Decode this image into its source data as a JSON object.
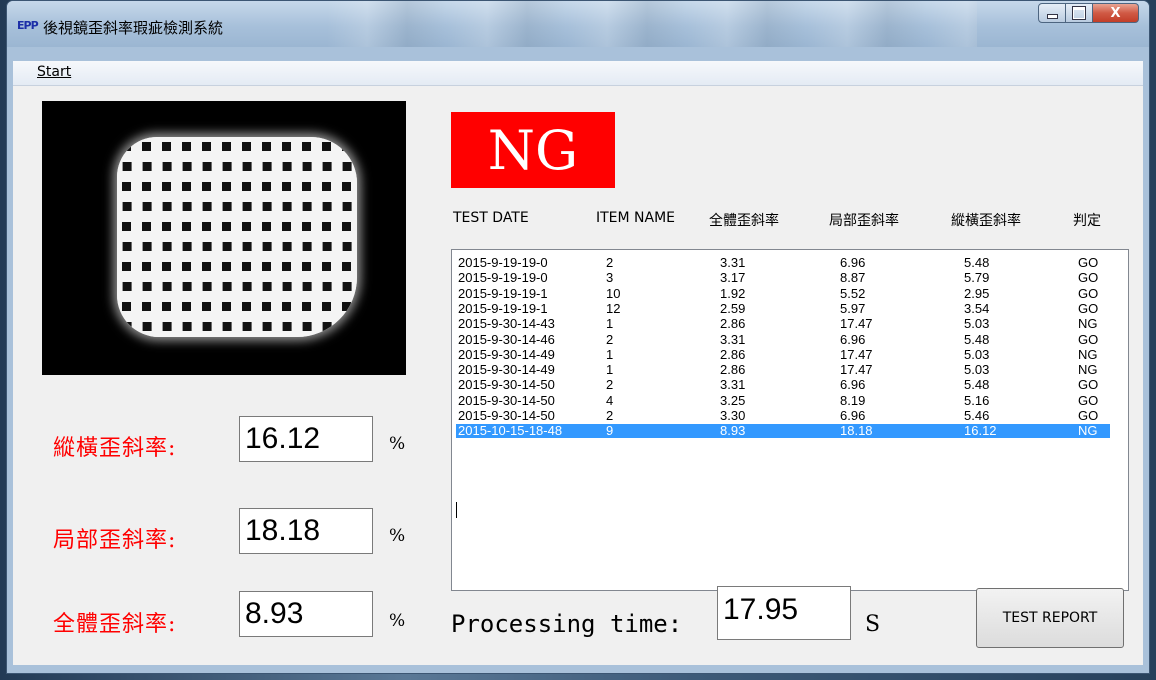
{
  "window": {
    "title": "後視鏡歪斜率瑕疵檢測系統",
    "icon_text": "EPP",
    "minimize_symbol": "",
    "maximize_symbol": "",
    "close_symbol": "X"
  },
  "menu": {
    "start_label": "Start"
  },
  "result": {
    "status": "NG",
    "status_color": "#ff0000"
  },
  "table": {
    "headers": [
      "TEST DATE",
      "ITEM NAME",
      "全體歪斜率",
      "局部歪斜率",
      "縱橫歪斜率",
      "判定"
    ],
    "rows": [
      [
        "2015-9-19-19-0",
        "2",
        "3.31",
        "6.96",
        "5.48",
        "GO"
      ],
      [
        "2015-9-19-19-0",
        "3",
        "3.17",
        "8.87",
        "5.79",
        "GO"
      ],
      [
        "2015-9-19-19-1",
        "10",
        "1.92",
        "5.52",
        "2.95",
        "GO"
      ],
      [
        "2015-9-19-19-1",
        "12",
        "2.59",
        "5.97",
        "3.54",
        "GO"
      ],
      [
        "2015-9-30-14-43",
        "1",
        "2.86",
        "17.47",
        "5.03",
        "NG"
      ],
      [
        "2015-9-30-14-46",
        "2",
        "3.31",
        "6.96",
        "5.48",
        "GO"
      ],
      [
        "2015-9-30-14-49",
        "1",
        "2.86",
        "17.47",
        "5.03",
        "NG"
      ],
      [
        "2015-9-30-14-49",
        "1",
        "2.86",
        "17.47",
        "5.03",
        "NG"
      ],
      [
        "2015-9-30-14-50",
        "2",
        "3.31",
        "6.96",
        "5.48",
        "GO"
      ],
      [
        "2015-9-30-14-50",
        "4",
        "3.25",
        "8.19",
        "5.16",
        "GO"
      ],
      [
        "2015-9-30-14-50",
        "2",
        "3.30",
        "6.96",
        "5.46",
        "GO"
      ],
      [
        "2015-10-15-18-48",
        "9",
        "8.93",
        "18.18",
        "16.12",
        "NG"
      ]
    ],
    "selected_row": 11,
    "selection_color": "#3399ff"
  },
  "metrics": {
    "aspect_label": "縱橫歪斜率:",
    "aspect_value": "16.12",
    "local_label": "局部歪斜率:",
    "local_value": "18.18",
    "overall_label": "全體歪斜率:",
    "overall_value": "8.93",
    "unit": "%"
  },
  "processing": {
    "label": "Processing time:",
    "value": "17.95",
    "unit": "S"
  },
  "buttons": {
    "test_report": "TEST REPORT"
  },
  "colors": {
    "accent_red": "#ff0000",
    "window_frame": "#a9c1da",
    "client_bg": "#f0f0f0"
  }
}
